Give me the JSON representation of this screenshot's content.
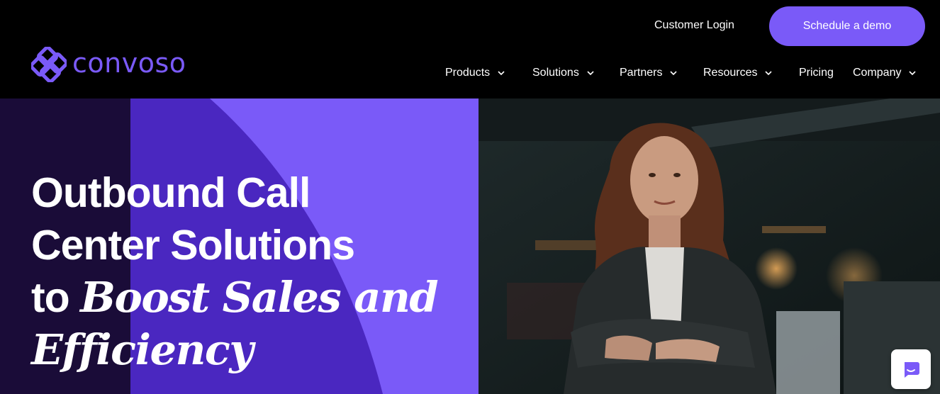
{
  "header": {
    "logo_text": "convoso",
    "customer_login": "Customer Login",
    "schedule_demo": "Schedule a demo",
    "nav": [
      {
        "label": "Products",
        "has_dropdown": true
      },
      {
        "label": "Solutions",
        "has_dropdown": true
      },
      {
        "label": "Partners",
        "has_dropdown": true
      },
      {
        "label": "Resources",
        "has_dropdown": true
      },
      {
        "label": "Pricing",
        "has_dropdown": false
      },
      {
        "label": "Company",
        "has_dropdown": true
      }
    ]
  },
  "hero": {
    "title_line1": "Outbound Call",
    "title_line2": "Center Solutions",
    "title_line3_plain": "to ",
    "title_line3_italic": "Boost Sales and",
    "title_line4_italic": "Efficiency",
    "photo_icon": "woman-portrait-image"
  },
  "chat": {
    "icon": "chat-bubble-icon"
  },
  "colors": {
    "brand_purple": "#7a5af8",
    "deep_purple": "#4a27c0",
    "darkest_purple": "#1a0c38",
    "header_bg": "#000000"
  }
}
